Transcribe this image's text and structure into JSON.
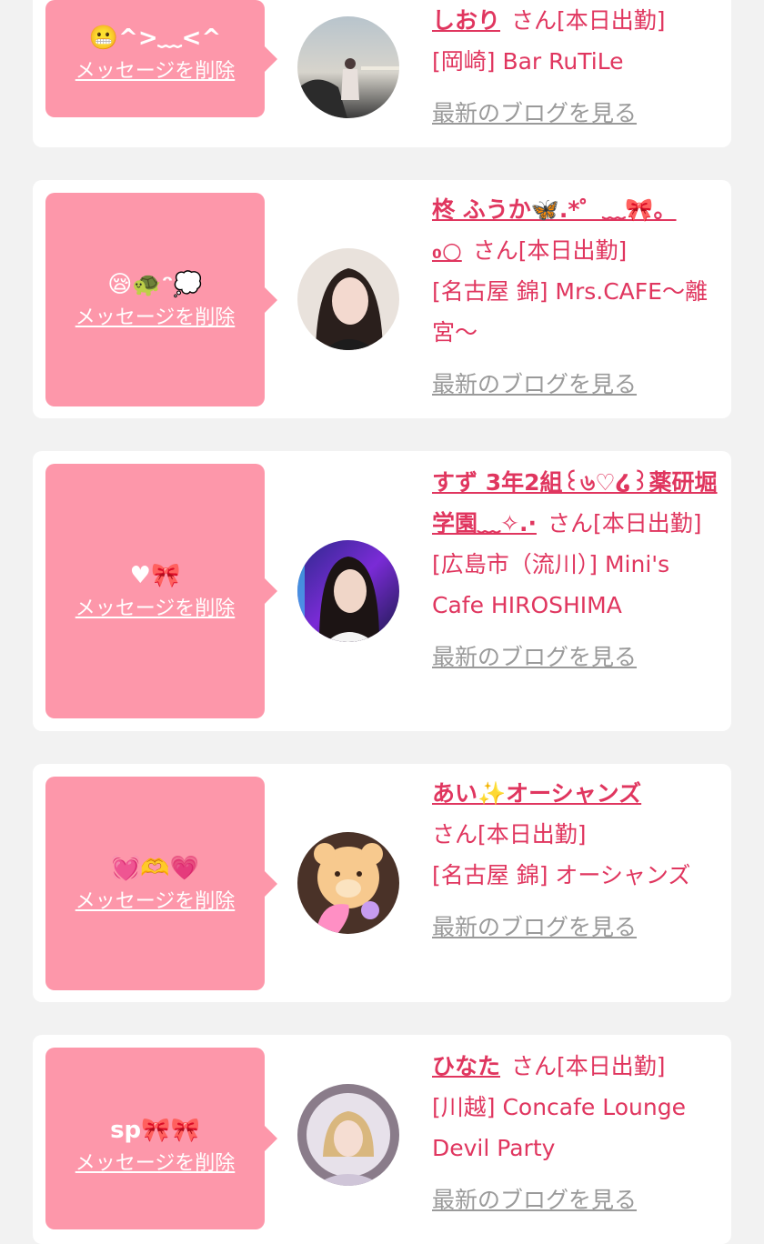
{
  "cards": [
    {
      "message": "😬^>﹏<^",
      "delete_label": "メッセージを削除",
      "name": "しおり",
      "suffix": "さん[本日出勤]",
      "store": "[岡崎] Bar RuTiLe",
      "blog_label": "最新のブログを見る"
    },
    {
      "message": "😪🐢ᵔ💭",
      "delete_label": "メッセージを削除",
      "name": "柊 ふうか🦋.*゜﹏🎀。",
      "name_cont": "₀○",
      "suffix": "さん[本日出勤]",
      "store": "[名古屋 錦] Mrs.CAFE～離宮～",
      "blog_label": "最新のブログを見る"
    },
    {
      "message": "♥🎀",
      "delete_label": "メッセージを削除",
      "name": "すず 3年2組꒰৬♡໒꒱薬研堀学園﹏✧.·",
      "suffix": "さん[本日出勤]",
      "store": "[広島市（流川）] Mini's Cafe HIROSHIMA",
      "blog_label": "最新のブログを見る"
    },
    {
      "message": "💓🫶💗",
      "delete_label": "メッセージを削除",
      "name": "あい✨オーシャンズ",
      "suffix": "さん[本日出勤]",
      "store": "[名古屋 錦] オーシャンズ",
      "blog_label": "最新のブログを見る"
    },
    {
      "message": "sp🎀🎀",
      "delete_label": "メッセージを削除",
      "name": "ひなた",
      "suffix": "さん[本日出勤]",
      "store": "[川越] Concafe Lounge Devil Party",
      "blog_label": "最新のブログを見る"
    }
  ]
}
